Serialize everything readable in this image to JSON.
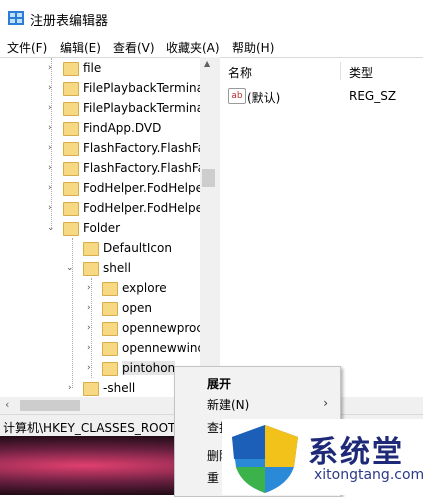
{
  "window": {
    "title": "注册表编辑器"
  },
  "menu": [
    "文件(F)",
    "编辑(E)",
    "查看(V)",
    "收藏夹(A)",
    "帮助(H)"
  ],
  "tree": {
    "items": [
      {
        "label": "file"
      },
      {
        "label": "FilePlaybackTermina"
      },
      {
        "label": "FilePlaybackTermina"
      },
      {
        "label": "FindApp.DVD"
      },
      {
        "label": "FlashFactory.FlashFa"
      },
      {
        "label": "FlashFactory.FlashFa"
      },
      {
        "label": "FodHelper.FodHelpe"
      },
      {
        "label": "FodHelper.FodHelpe"
      },
      {
        "label": "Folder"
      },
      {
        "label": "DefaultIcon"
      },
      {
        "label": "shell"
      },
      {
        "label": "explore"
      },
      {
        "label": "open"
      },
      {
        "label": "opennewproc"
      },
      {
        "label": "opennewwind"
      },
      {
        "label": "pintohon"
      },
      {
        "label": "-shell"
      }
    ]
  },
  "list": {
    "headers": {
      "name": "名称",
      "type": "类型"
    },
    "rows": [
      {
        "icon": "ab",
        "name": "(默认)",
        "type": "REG_SZ"
      }
    ]
  },
  "status": {
    "path": "计算机\\HKEY_CLASSES_ROOT\\"
  },
  "context_menu": {
    "items": [
      "展开",
      "新建(N)",
      "查找",
      "删除",
      "重"
    ],
    "submenu_arrow": "›"
  },
  "watermark": {
    "cn": "系统堂",
    "en": "xitongtang.com"
  }
}
